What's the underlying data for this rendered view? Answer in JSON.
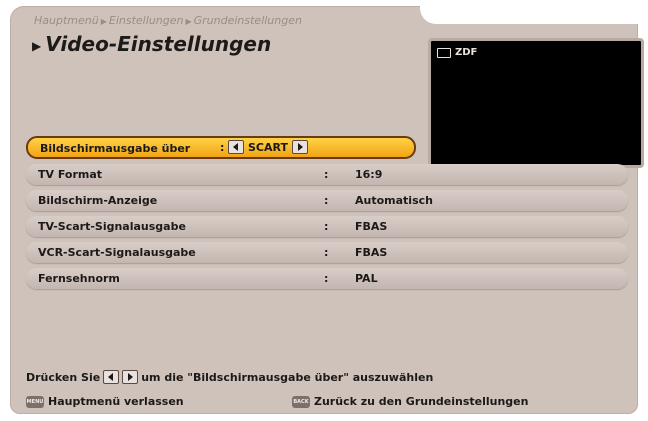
{
  "header": {
    "breadcrumb": [
      "Hauptmenü",
      "Einstellungen",
      "Grundeinstellungen"
    ],
    "title": "Video-Einstellungen"
  },
  "preview": {
    "channel": "ZDF"
  },
  "settings": {
    "selected": {
      "label": "Bildschirmausgabe über",
      "value": "SCART"
    },
    "rows": [
      {
        "label": "TV Format",
        "value": "16:9"
      },
      {
        "label": "Bildschirm-Anzeige",
        "value": "Automatisch"
      },
      {
        "label": "TV-Scart-Signalausgabe",
        "value": "FBAS"
      },
      {
        "label": "VCR-Scart-Signalausgabe",
        "value": "FBAS"
      },
      {
        "label": "Fernsehnorm",
        "value": "PAL"
      }
    ]
  },
  "hint": {
    "prefix": "Drücken Sie",
    "suffix": "um die \"Bildschirmausgabe über\" auszuwählen"
  },
  "footer": {
    "menu_key": "MENU",
    "menu_label": "Hauptmenü verlassen",
    "back_key": "BACK",
    "back_label": "Zurück zu den Grundeinstellungen"
  },
  "colors": {
    "panel": "#cfc2bb",
    "highlight": "#f7b52a",
    "preview": "#000000"
  }
}
